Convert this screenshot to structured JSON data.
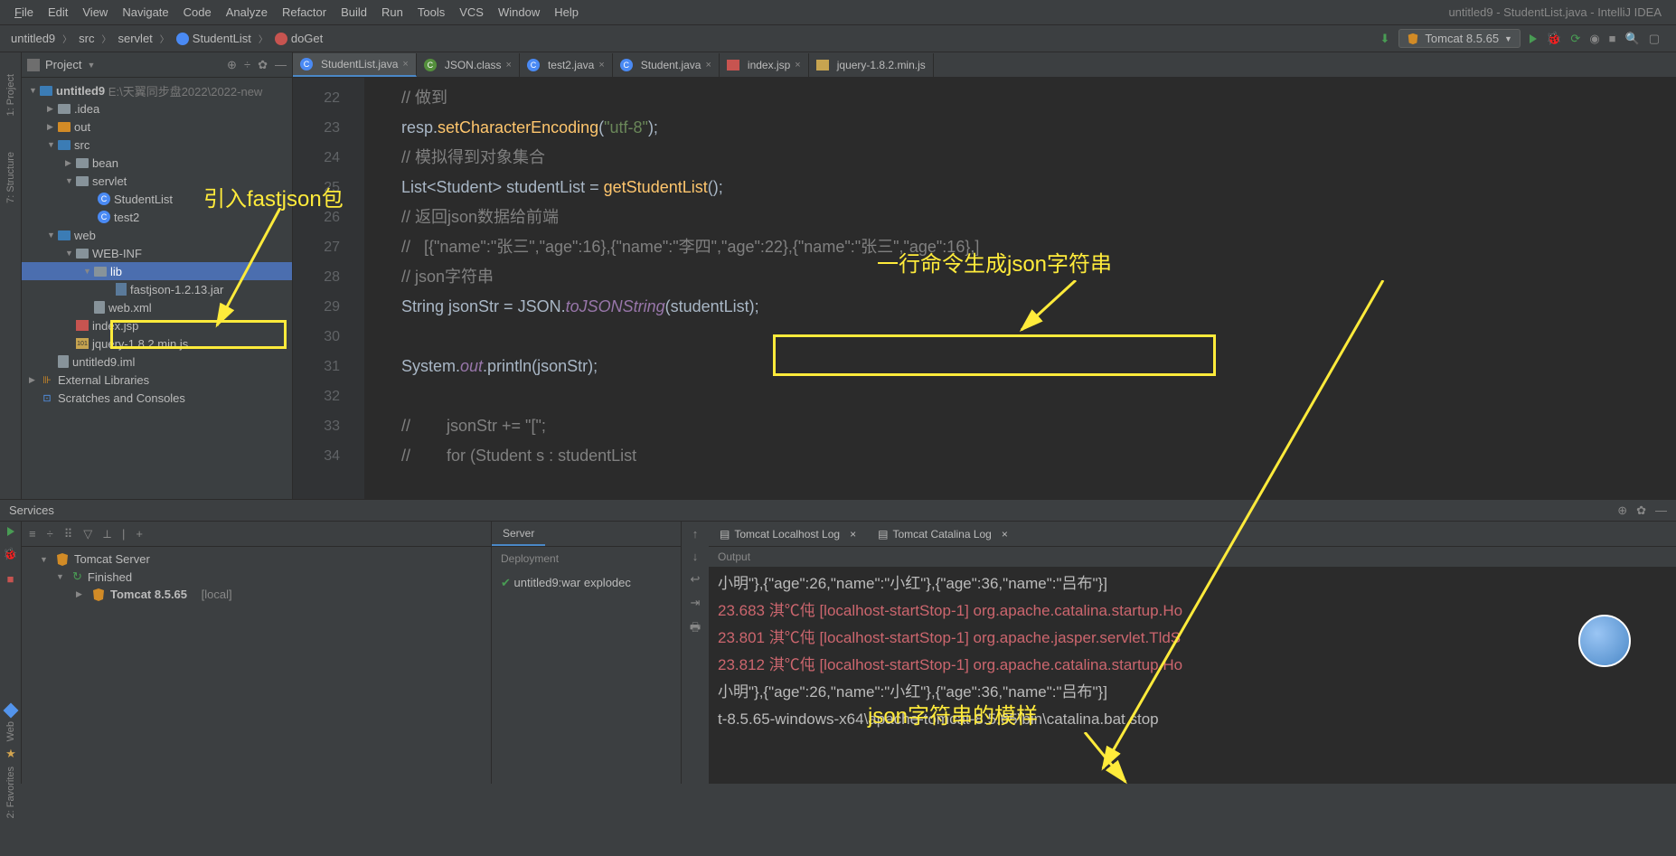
{
  "menu": {
    "file": "File",
    "edit": "Edit",
    "view": "View",
    "navigate": "Navigate",
    "code": "Code",
    "analyze": "Analyze",
    "refactor": "Refactor",
    "build": "Build",
    "run": "Run",
    "tools": "Tools",
    "vcs": "VCS",
    "window": "Window",
    "help": "Help"
  },
  "window_title": "untitled9 - StudentList.java - IntelliJ IDEA",
  "breadcrumbs": {
    "root": "untitled9",
    "src": "src",
    "pkg": "servlet",
    "cls": "StudentList",
    "method": "doGet"
  },
  "run_config": "Tomcat 8.5.65",
  "sidebar": {
    "title": "Project",
    "left_labels": {
      "project": "1: Project",
      "structure": "7: Structure"
    },
    "root": {
      "name": "untitled9",
      "path": "E:\\天翼同步盘2022\\2022-new"
    },
    "nodes": {
      "idea": ".idea",
      "out": "out",
      "src": "src",
      "bean": "bean",
      "servlet": "servlet",
      "student_list": "StudentList",
      "test2": "test2",
      "web": "web",
      "webinf": "WEB-INF",
      "lib": "lib",
      "jar": "fastjson-1.2.13.jar",
      "webxml": "web.xml",
      "indexjsp": "index.jsp",
      "jquery": "jquery-1.8.2.min.js",
      "iml": "untitled9.iml",
      "ext": "External Libraries",
      "scratches": "Scratches and Consoles"
    }
  },
  "tabs": [
    {
      "label": "StudentList.java",
      "icon": "class",
      "active": true
    },
    {
      "label": "JSON.class",
      "icon": "class",
      "active": false
    },
    {
      "label": "test2.java",
      "icon": "class",
      "active": false
    },
    {
      "label": "Student.java",
      "icon": "class",
      "active": false
    },
    {
      "label": "index.jsp",
      "icon": "jsp",
      "active": false
    },
    {
      "label": "jquery-1.8.2.min.js",
      "icon": "js",
      "active": false
    }
  ],
  "code": {
    "lines": [
      "22",
      "23",
      "24",
      "25",
      "26",
      "27",
      "28",
      "29",
      "30",
      "31",
      "32",
      "33",
      "34"
    ],
    "l22": "// 做到",
    "l23a": "resp.",
    "l23b": "setCharacterEncoding",
    "l23c": "(",
    "l23d": "\"utf-8\"",
    "l23e": ");",
    "l24": "// 模拟得到对象集合",
    "l25a": "List<Student> studentList = ",
    "l25b": "getStudentList",
    "l25c": "();",
    "l26": "// 返回json数据给前端",
    "l27": "//   [{\"name\":\"张三\",\"age\":16},{\"name\":\"李四\",\"age\":22},{\"name\":\"张三\",\"age\":16},]",
    "l28": "// json字符串",
    "l29a": "String jsonStr = ",
    "l29b": "JSON.",
    "l29c": "toJSONString",
    "l29d": "(studentList);",
    "l31a": "System.",
    "l31b": "out",
    "l31c": ".println(jsonStr);",
    "l33": "//        jsonStr += \"[\";",
    "l34": "//        for (Student s : studentList"
  },
  "services": {
    "title": "Services",
    "tree": {
      "root": "Tomcat Server",
      "finished": "Finished",
      "item": "Tomcat 8.5.65",
      "item_suffix": "[local]"
    },
    "mid": {
      "tab": "Server",
      "dep_label": "Deployment",
      "artifact": "untitled9:war explodec"
    },
    "right_tabs": {
      "log1": "Tomcat Localhost Log",
      "log2": "Tomcat Catalina Log"
    },
    "output_label": "Output",
    "console": {
      "l1": "小明\"},{\"age\":26,\"name\":\"小红\"},{\"age\":36,\"name\":\"吕布\"}]",
      "l2": "23.683 淇℃伅 [localhost-startStop-1] org.apache.catalina.startup.Ho",
      "l3": "23.801 淇℃伅 [localhost-startStop-1] org.apache.jasper.servlet.TldS",
      "l4": "23.812 淇℃伅 [localhost-startStop-1] org.apache.catalina.startup.Ho",
      "l5": "小明\"},{\"age\":26,\"name\":\"小红\"},{\"age\":36,\"name\":\"吕布\"}]",
      "l6": "t-8.5.65-windows-x64\\apache-tomcat-8.5.65\\bin\\catalina.bat stop"
    }
  },
  "annotations": {
    "a1": "引入fastjson包",
    "a2": "一行命令生成json字符串",
    "a3": "json字符串的模样"
  },
  "left_bottom": {
    "web": "Web",
    "fav": "2: Favorites"
  }
}
